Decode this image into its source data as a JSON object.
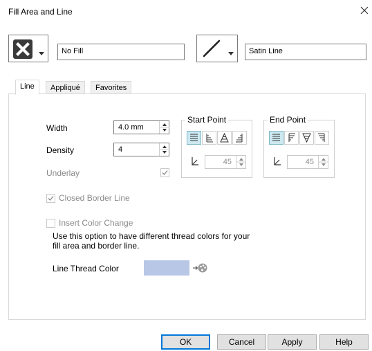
{
  "window": {
    "title": "Fill Area and Line"
  },
  "fill": {
    "value": "No Fill",
    "icon": "no-fill-icon"
  },
  "line": {
    "value": "Satin Line",
    "icon": "satin-line-icon"
  },
  "tabs": [
    {
      "label": "Line",
      "active": true
    },
    {
      "label": "Appliqué",
      "active": false
    },
    {
      "label": "Favorites",
      "active": false
    }
  ],
  "fields": {
    "width_label": "Width",
    "width_value": "4.0 mm",
    "density_label": "Density",
    "density_value": "4",
    "underlay_label": "Underlay",
    "underlay_checked": true
  },
  "start_point": {
    "title": "Start Point",
    "angle": "45"
  },
  "end_point": {
    "title": "End Point",
    "angle": "45"
  },
  "closed_border": {
    "label": "Closed Border Line",
    "checked": true,
    "enabled": false
  },
  "insert_color_change": {
    "label": "Insert Color Change",
    "checked": false,
    "description_line1": "Use this option to have different thread colors for your",
    "description_line2": "fill area and border line."
  },
  "thread_color": {
    "label": "Line Thread Color",
    "color": "#b8c7e6"
  },
  "buttons": {
    "ok": "OK",
    "cancel": "Cancel",
    "apply": "Apply",
    "help": "Help"
  }
}
